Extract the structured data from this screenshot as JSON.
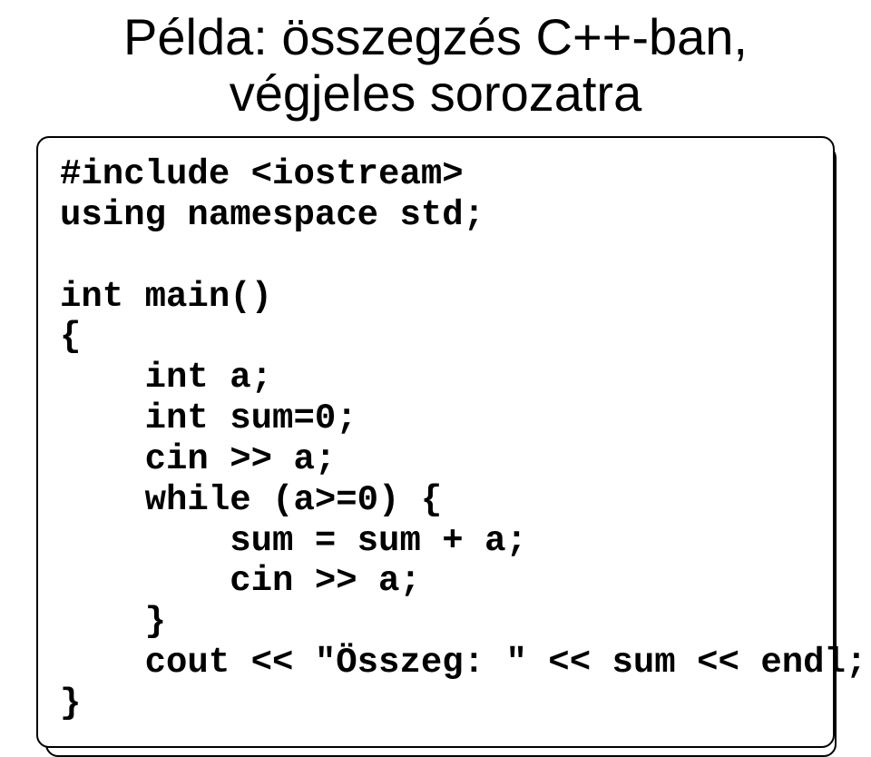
{
  "title_line1": "Példa: összegzés C++-ban,",
  "title_line2": "végjeles sorozatra",
  "code": {
    "l1": "#include <iostream>",
    "l2": "using namespace std;",
    "l3": "",
    "l4": "int main()",
    "l5": "{",
    "l6": "    int a;",
    "l7": "    int sum=0;",
    "l8": "    cin >> a;",
    "l9": "    while (a>=0) {",
    "l10": "        sum = sum + a;",
    "l11": "        cin >> a;",
    "l12": "    }",
    "l13": "    cout << \"Összeg: \" << sum << endl;",
    "l14": "}"
  }
}
